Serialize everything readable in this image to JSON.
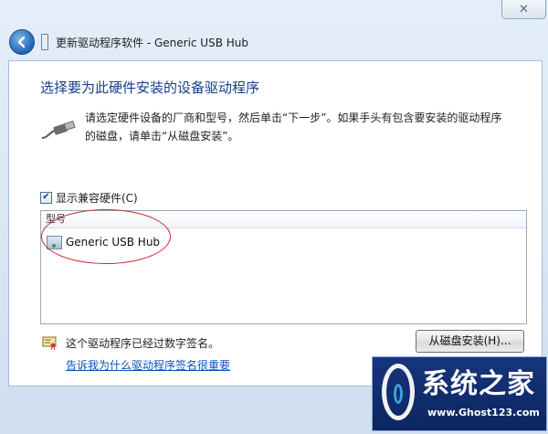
{
  "window": {
    "close_label": "✕",
    "title": "更新驱动程序软件 - Generic USB Hub"
  },
  "content": {
    "heading": "选择要为此硬件安装的设备驱动程序",
    "instructions": "请选定硬件设备的厂商和型号，然后单击“下一步”。如果手头有包含要安装的驱动程序的磁盘，请单击“从磁盘安装”。",
    "show_compatible": {
      "label": "显示兼容硬件(C)",
      "checked": true,
      "check_glyph": "✔"
    },
    "model_list": {
      "column_header": "型号",
      "items": [
        "Generic USB Hub"
      ]
    },
    "signature_text": "这个驱动程序已经过数字签名。",
    "signature_link": "告诉我为什么驱动程序签名很重要",
    "have_disk_button": "从磁盘安装(H)..."
  },
  "watermark": {
    "title": "系统之家",
    "url": "www.Ghost123.com"
  },
  "icons": {
    "back": "back-arrow-icon",
    "device": "device-icon",
    "usb": "usb-cable-icon",
    "hardware": "hardware-device-icon",
    "certificate": "certificate-icon"
  },
  "colors": {
    "heading": "#1a3c8a",
    "link": "#0b53b8",
    "annotation": "#c62828",
    "watermark_bg": "#17357c"
  }
}
